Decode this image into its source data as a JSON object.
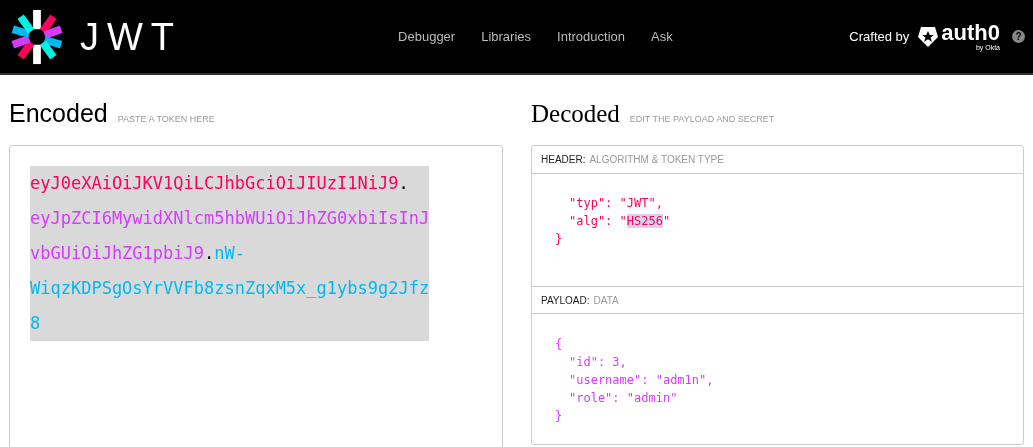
{
  "brand": {
    "name": "JWT"
  },
  "nav": [
    {
      "label": "Debugger"
    },
    {
      "label": "Libraries"
    },
    {
      "label": "Introduction"
    },
    {
      "label": "Ask"
    }
  ],
  "credit": {
    "label": "Crafted by",
    "logo_text": "auth0",
    "logo_sub": "by Okta",
    "help": "?"
  },
  "encoded": {
    "title": "Encoded",
    "hint": "PASTE A TOKEN HERE",
    "segments": [
      {
        "kind": "header",
        "text": "eyJ0eXAiOiJKV1QiLCJhbGciOiJIUzI1NiJ9",
        "color": "#fb015b"
      },
      {
        "kind": "dot",
        "text": "."
      },
      {
        "kind": "payload",
        "text": "eyJpZCI6MywidXNlcm5hbWUiOiJhZG0xbiIsInJvbGUiOiJhZG1pbiJ9",
        "color": "#d63aff"
      },
      {
        "kind": "dot",
        "text": "."
      },
      {
        "kind": "signature",
        "text": "nW-WiqzKDPSgOsYrVVFb8zsnZqxM5x_g1ybs9g2Jfz8",
        "color": "#00b9f1"
      }
    ]
  },
  "decoded": {
    "title": "Decoded",
    "hint": "EDIT THE PAYLOAD AND SECRET",
    "sections": [
      {
        "label": "HEADER:",
        "sublabel": "ALGORITHM & TOKEN TYPE",
        "color": "#fb015b",
        "lines": [
          {
            "kind": "member",
            "parts": [
              {
                "text": "\"typ\": \"JWT\",",
                "selected": false
              }
            ]
          },
          {
            "kind": "member",
            "parts": [
              {
                "text": "\"alg\": \"",
                "selected": false
              },
              {
                "text": "HS256",
                "selected": true
              },
              {
                "text": "\"",
                "selected": false
              }
            ]
          },
          {
            "kind": "brace",
            "parts": [
              {
                "text": "}",
                "selected": false
              }
            ]
          }
        ]
      },
      {
        "label": "PAYLOAD:",
        "sublabel": "DATA",
        "color": "#d63aff",
        "lines": [
          {
            "kind": "brace",
            "parts": [
              {
                "text": "{",
                "selected": false
              }
            ]
          },
          {
            "kind": "member",
            "parts": [
              {
                "text": "\"id\": 3,",
                "selected": false
              }
            ]
          },
          {
            "kind": "member",
            "parts": [
              {
                "text": "\"username\": \"adm1n\",",
                "selected": false
              }
            ]
          },
          {
            "kind": "member",
            "parts": [
              {
                "text": "\"role\": \"admin\"",
                "selected": false
              }
            ]
          },
          {
            "kind": "brace",
            "parts": [
              {
                "text": "}",
                "selected": false
              }
            ]
          }
        ]
      }
    ]
  }
}
